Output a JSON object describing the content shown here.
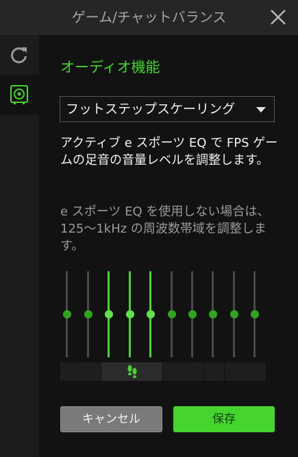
{
  "window": {
    "title": "ゲーム/チャットバランス",
    "close_icon": "close-icon"
  },
  "sidebar": {
    "items": [
      {
        "name": "refresh",
        "icon": "refresh-icon",
        "active": false
      },
      {
        "name": "audio",
        "icon": "speaker-icon",
        "active": true
      }
    ]
  },
  "main": {
    "heading": "オーディオ機能",
    "preset": {
      "value": "フットステップスケーリング",
      "arrow_icon": "caret-down-icon"
    },
    "description": "アクティブ e スポーツ EQ で FPS ゲームの足音の音量レベルを調整します。",
    "note": "e スポーツ EQ を使用しない場合は、125〜1kHz の周波数帯域を調整します。"
  },
  "eq": {
    "bands": [
      {
        "level": 0.5,
        "highlighted": false
      },
      {
        "level": 0.5,
        "highlighted": false
      },
      {
        "level": 0.5,
        "highlighted": true
      },
      {
        "level": 0.5,
        "highlighted": true
      },
      {
        "level": 0.5,
        "highlighted": true
      },
      {
        "level": 0.5,
        "highlighted": false
      },
      {
        "level": 0.5,
        "highlighted": false
      },
      {
        "level": 0.5,
        "highlighted": false
      },
      {
        "level": 0.5,
        "highlighted": false
      },
      {
        "level": 0.5,
        "highlighted": false
      }
    ],
    "footstep_icon": "footsteps-icon"
  },
  "buttons": {
    "cancel": "キャンセル",
    "save": "保存"
  },
  "colors": {
    "accent": "#44d62c",
    "background": "#121212",
    "titlebar": "#262626"
  }
}
